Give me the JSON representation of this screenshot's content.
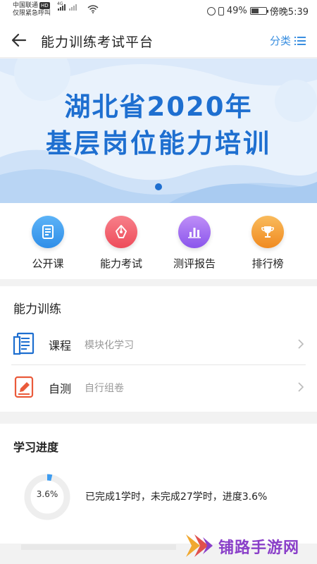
{
  "status_bar": {
    "carrier": "中国联通",
    "hd_badge": "HD",
    "emergency_text": "仅限紧急呼叫",
    "network_type": "4G",
    "battery_percent": "49%",
    "battery_level": 0.49,
    "time": "傍晚5:39"
  },
  "navbar": {
    "title": "能力训练考试平台",
    "category_label": "分类",
    "back_icon": "arrow-left-icon",
    "category_icon": "list-icon"
  },
  "banner": {
    "line1": "湖北省2020年",
    "line2": "基层岗位能力培训",
    "active_slide": 1,
    "slide_count": 1
  },
  "quick_menu": {
    "items": [
      {
        "label": "公开课",
        "icon": "document-icon",
        "color": "#3d9cf0"
      },
      {
        "label": "能力考试",
        "icon": "pen-nib-icon",
        "color": "#f2606c"
      },
      {
        "label": "测评报告",
        "icon": "bar-chart-icon",
        "color": "#a46ef2"
      },
      {
        "label": "排行榜",
        "icon": "trophy-icon",
        "color": "#f5a03a"
      }
    ]
  },
  "training": {
    "title": "能力训练",
    "rows": [
      {
        "title": "课程",
        "subtitle": "模块化学习",
        "icon": "course-document-icon"
      },
      {
        "title": "自测",
        "subtitle": "自行组卷",
        "icon": "self-test-pencil-icon"
      }
    ]
  },
  "progress": {
    "title": "学习进度",
    "percent_label": "3.6%",
    "percent_value": 3.6,
    "summary": "已完成1学时，未完成27学时，进度3.6%"
  },
  "watermark": {
    "text": "铺路手游网"
  },
  "colors": {
    "accent": "#1e6fd0",
    "link": "#3a8fe0",
    "watermark": "#8a3fc9"
  }
}
